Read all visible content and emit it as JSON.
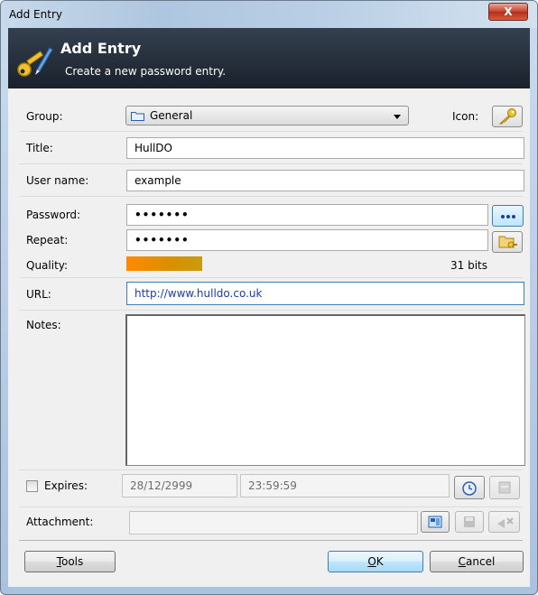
{
  "window": {
    "title": "Add Entry",
    "close_label": "X"
  },
  "banner": {
    "title": "Add Entry",
    "subtitle": "Create a new password entry."
  },
  "form": {
    "group_label": "Group:",
    "group_value": "General",
    "icon_label": "Icon:",
    "title_label": "Title:",
    "title_value": "HullDO",
    "username_label": "User name:",
    "username_value": "example",
    "password_label": "Password:",
    "password_value": "•••••••",
    "repeat_label": "Repeat:",
    "repeat_value": "•••••••",
    "quality_label": "Quality:",
    "quality_text": "31 bits",
    "quality_fraction": 0.15,
    "url_label": "URL:",
    "url_value": "http://www.hulldo.co.uk",
    "notes_label": "Notes:",
    "notes_value": "",
    "expires_label": "Expires:",
    "expires_checked": false,
    "expires_date": "28/12/2999",
    "expires_time": "23:59:59",
    "attachment_label": "Attachment:",
    "attachment_value": ""
  },
  "buttons": {
    "tools_prefix": "T",
    "tools_rest": "ools",
    "ok_prefix": "O",
    "ok_rest": "K",
    "cancel_prefix": "C",
    "cancel_rest": "ancel"
  },
  "icons": {
    "banner": "key-pen-icon",
    "entry_icon": "key-icon",
    "group": "folder-icon",
    "show_password": "dots-icon",
    "generate": "folder-key-icon",
    "date_picker": "clock-icon",
    "expiry_presets": "calendar-icon",
    "attach": "attach-file-icon",
    "save_attachment": "save-icon",
    "delete_attachment": "delete-icon"
  },
  "colors": {
    "banner_bg": "#1f2733",
    "quality_bar": "#ff8a00",
    "url_text": "#1a3ea8",
    "focus_border": "#3c7fb1"
  }
}
